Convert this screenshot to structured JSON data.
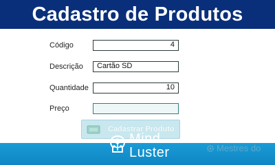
{
  "header": {
    "title": "Cadastro de Produtos"
  },
  "form": {
    "codigo": {
      "label": "Código",
      "value": "4"
    },
    "descricao": {
      "label": "Descrição",
      "value": "Cartão SD"
    },
    "quantidade": {
      "label": "Quantidade",
      "value": "10"
    },
    "preco": {
      "label": "Preço",
      "value": ""
    }
  },
  "submit_button": {
    "label": "Cadastrar Produto",
    "icon": "cart-icon"
  },
  "watermark": {
    "brand_line1": "Mind",
    "brand_line2": "Luster",
    "brand_icon": "brain-icon",
    "right_text": "Mestres do"
  },
  "colors": {
    "header_bg": "#0a2f7a",
    "footer_bg": "#1a9bd6",
    "button_bg": "#c9e7ef"
  }
}
